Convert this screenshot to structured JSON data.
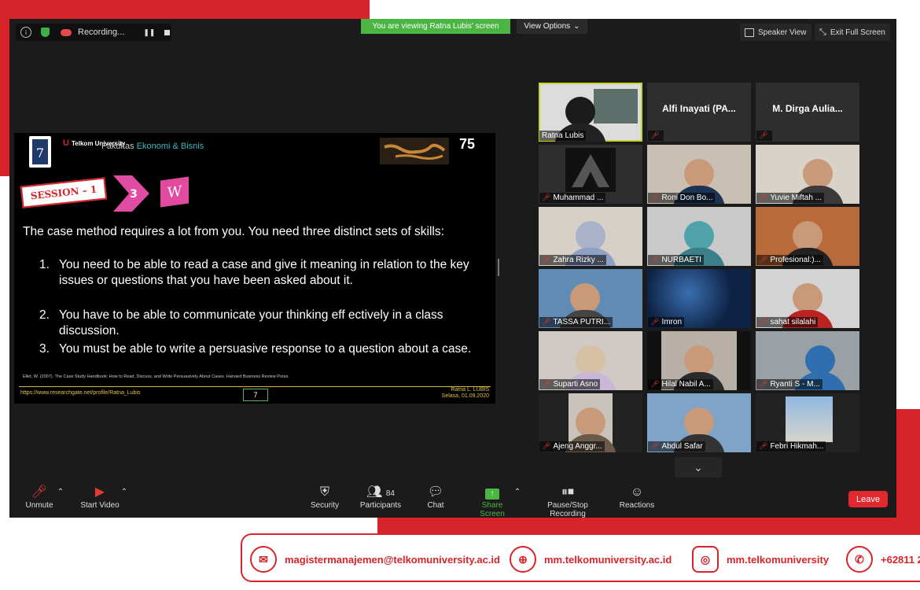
{
  "topbar": {
    "recording_label": "Recording...",
    "banner": "You are viewing Ratna Lubis' screen",
    "view_options": "View Options",
    "speaker_view": "Speaker View",
    "exit_full_screen": "Exit Full Screen"
  },
  "slide": {
    "brand": "Telkom University",
    "faculty_a": "Fakultas ",
    "faculty_b": "Ekonomi & Bisnis",
    "session": "SESSION – 1",
    "step": "3",
    "cube": "W",
    "intro": "The case method requires a lot from you. You need three distinct sets of skills:",
    "items": [
      {
        "num": "1.",
        "text": "You need to be able to read a case and give it meaning in relation to the key issues or questions that you have been asked about it."
      },
      {
        "num": "2.",
        "text": "You have to be able to communicate your thinking eff ectively in a class discussion."
      },
      {
        "num": "3.",
        "text": "You must be able to write a persuasive response to a question about a case."
      }
    ],
    "citation": "Ellet, W. (2007). The Case Study Handbook: How to Read, Discuss, and Write Persuasively About Cases. Harvard Business Review Press.",
    "url": "https://www.researchgate.net/profile/Ratna_Lubis",
    "page": "7",
    "author": "Ratna L. LUBIS",
    "date": "Selasa, 01.09.2020",
    "anniv": "75"
  },
  "participants": [
    {
      "name": "Ratna Lubis"
    },
    {
      "name": "",
      "display": "Alfi Inayati (PA..."
    },
    {
      "name": "",
      "display": "M. Dirga Aulia..."
    },
    {
      "name": "Muhammad ..."
    },
    {
      "name": "Roni Don Bo..."
    },
    {
      "name": "Yuvie Miftah ..."
    },
    {
      "name": "Zahra Rizky ..."
    },
    {
      "name": "NURBAETI"
    },
    {
      "name": "Profesional:)..."
    },
    {
      "name": "TASSA PUTRI..."
    },
    {
      "name": "Imron"
    },
    {
      "name": "sahat silalahi"
    },
    {
      "name": "Suparti Asno"
    },
    {
      "name": "Hilal Nabil A..."
    },
    {
      "name": "Ryanti S - M..."
    },
    {
      "name": "Ajeng Anggr..."
    },
    {
      "name": "Abdul Safar"
    },
    {
      "name": "Febri Hikmah..."
    }
  ],
  "toolbar": {
    "unmute": "Unmute",
    "start_video": "Start Video",
    "security": "Security",
    "participants": "Participants",
    "participants_count": "84",
    "chat": "Chat",
    "share_screen": "Share Screen",
    "pause_recording": "Pause/Stop Recording",
    "reactions": "Reactions",
    "leave": "Leave"
  },
  "footer": {
    "email": "magistermanajemen@telkomuniversity.ac.id",
    "website": "mm.telkomuniversity.ac.id",
    "instagram": "mm.telkomuniversity",
    "phone": "+62811 2"
  },
  "colors": {
    "brand_red": "#d7242b",
    "banner_green": "#4bb543",
    "active_speaker": "#c6d629"
  }
}
